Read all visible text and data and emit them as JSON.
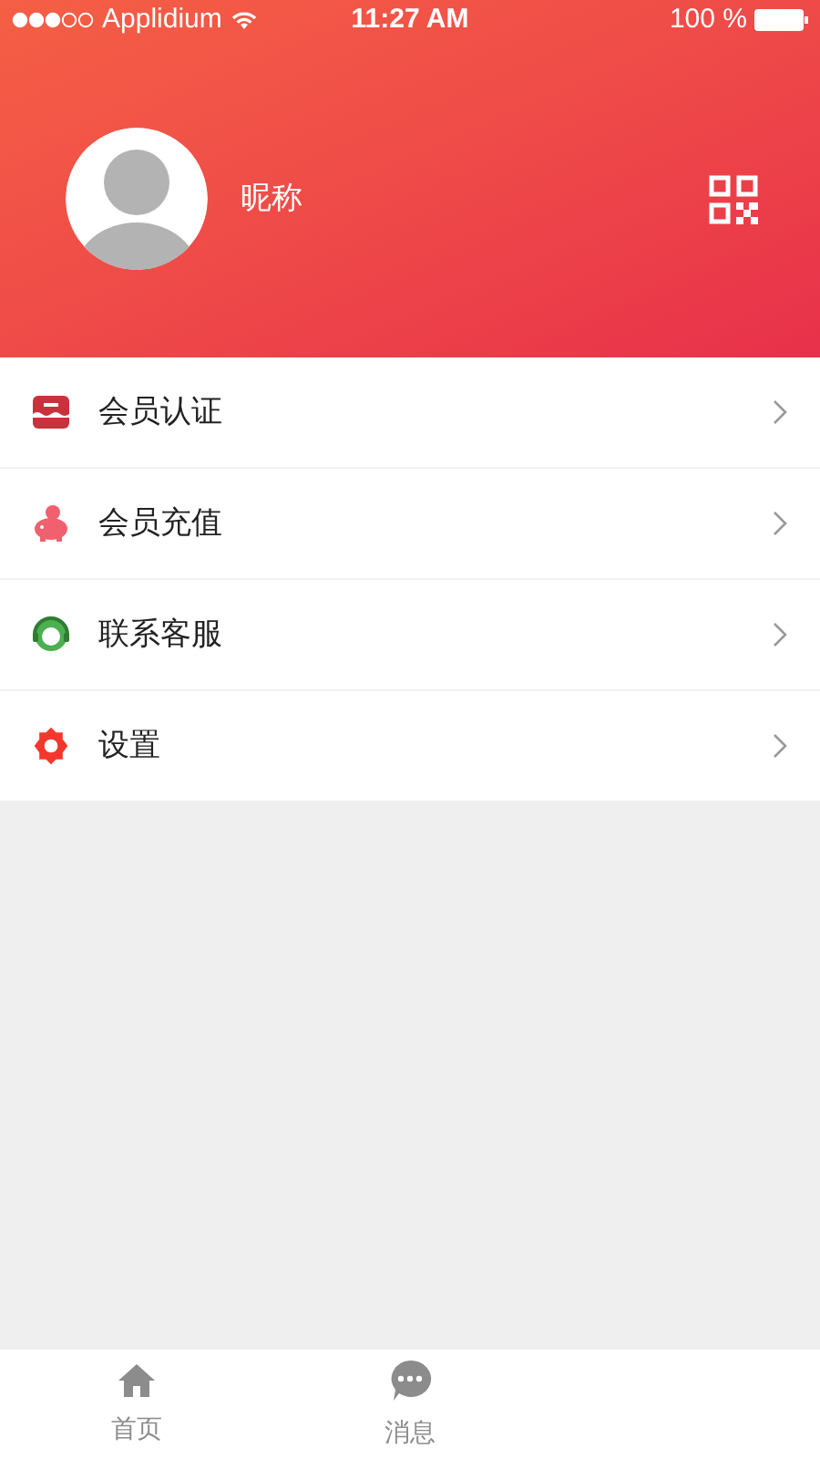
{
  "status_bar": {
    "carrier": "Applidium",
    "time": "11:27 AM",
    "battery": "100 %"
  },
  "profile": {
    "nickname": "昵称"
  },
  "menu": [
    {
      "label": "会员认证",
      "kind": "store"
    },
    {
      "label": "会员充值",
      "kind": "piggy"
    },
    {
      "label": "联系客服",
      "kind": "support"
    },
    {
      "label": "设置",
      "kind": "gear"
    }
  ],
  "tab_bar": [
    {
      "label": "首页",
      "kind": "home"
    },
    {
      "label": "消息",
      "kind": "chat"
    }
  ]
}
